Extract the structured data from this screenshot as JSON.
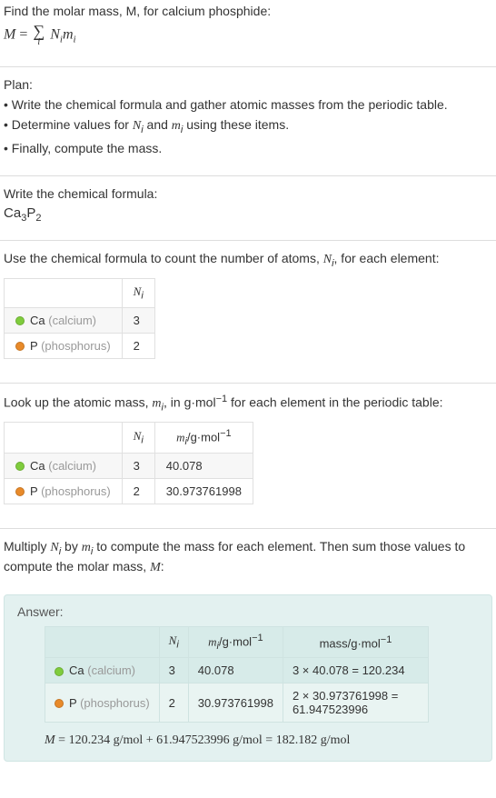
{
  "intro": {
    "line1": "Find the molar mass, M, for calcium phosphide:",
    "formula_lhs": "M",
    "formula_eq": " = ",
    "formula_rhs_var1": "N",
    "formula_rhs_var2": "m",
    "formula_sub": "i"
  },
  "plan": {
    "heading": "Plan:",
    "b1": "Write the chemical formula and gather atomic masses from the periodic table.",
    "b2_pre": "Determine values for ",
    "b2_n": "N",
    "b2_and": " and ",
    "b2_m": "m",
    "b2_post": " using these items.",
    "b3": "Finally, compute the mass."
  },
  "chemformula": {
    "heading": "Write the chemical formula:",
    "ca": "Ca",
    "ca_n": "3",
    "p": "P",
    "p_n": "2"
  },
  "count": {
    "heading_pre": "Use the chemical formula to count the number of atoms, ",
    "heading_var": "N",
    "heading_post": ", for each element:",
    "col_ni": "N",
    "ca_sym": "Ca",
    "ca_name": "(calcium)",
    "ca_n": "3",
    "p_sym": "P",
    "p_name": "(phosphorus)",
    "p_n": "2"
  },
  "lookup": {
    "heading_pre": "Look up the atomic mass, ",
    "heading_var": "m",
    "heading_mid": ", in g·mol",
    "heading_exp": "−1",
    "heading_post": " for each element in the periodic table:",
    "col_ni": "N",
    "col_mi": "m",
    "col_mi_unit": "/g·mol",
    "col_mi_exp": "−1",
    "ca_sym": "Ca",
    "ca_name": "(calcium)",
    "ca_n": "3",
    "ca_m": "40.078",
    "p_sym": "P",
    "p_name": "(phosphorus)",
    "p_n": "2",
    "p_m": "30.973761998"
  },
  "multiply": {
    "line_pre": "Multiply ",
    "n": "N",
    "by": " by ",
    "m": "m",
    "line_post": " to compute the mass for each element. Then sum those values to compute the molar mass, ",
    "mvar": "M",
    "colon": ":"
  },
  "answer": {
    "label": "Answer:",
    "col_ni": "N",
    "col_mi": "m",
    "col_mi_unit": "/g·mol",
    "col_exp": "−1",
    "col_mass": "mass/g·mol",
    "ca_sym": "Ca",
    "ca_name": "(calcium)",
    "ca_n": "3",
    "ca_m": "40.078",
    "ca_mass": "3 × 40.078 = 120.234",
    "p_sym": "P",
    "p_name": "(phosphorus)",
    "p_n": "2",
    "p_m": "30.973761998",
    "p_mass": "2 × 30.973761998 = 61.947523996",
    "final": "M = 120.234 g/mol + 61.947523996 g/mol = 182.182 g/mol"
  }
}
